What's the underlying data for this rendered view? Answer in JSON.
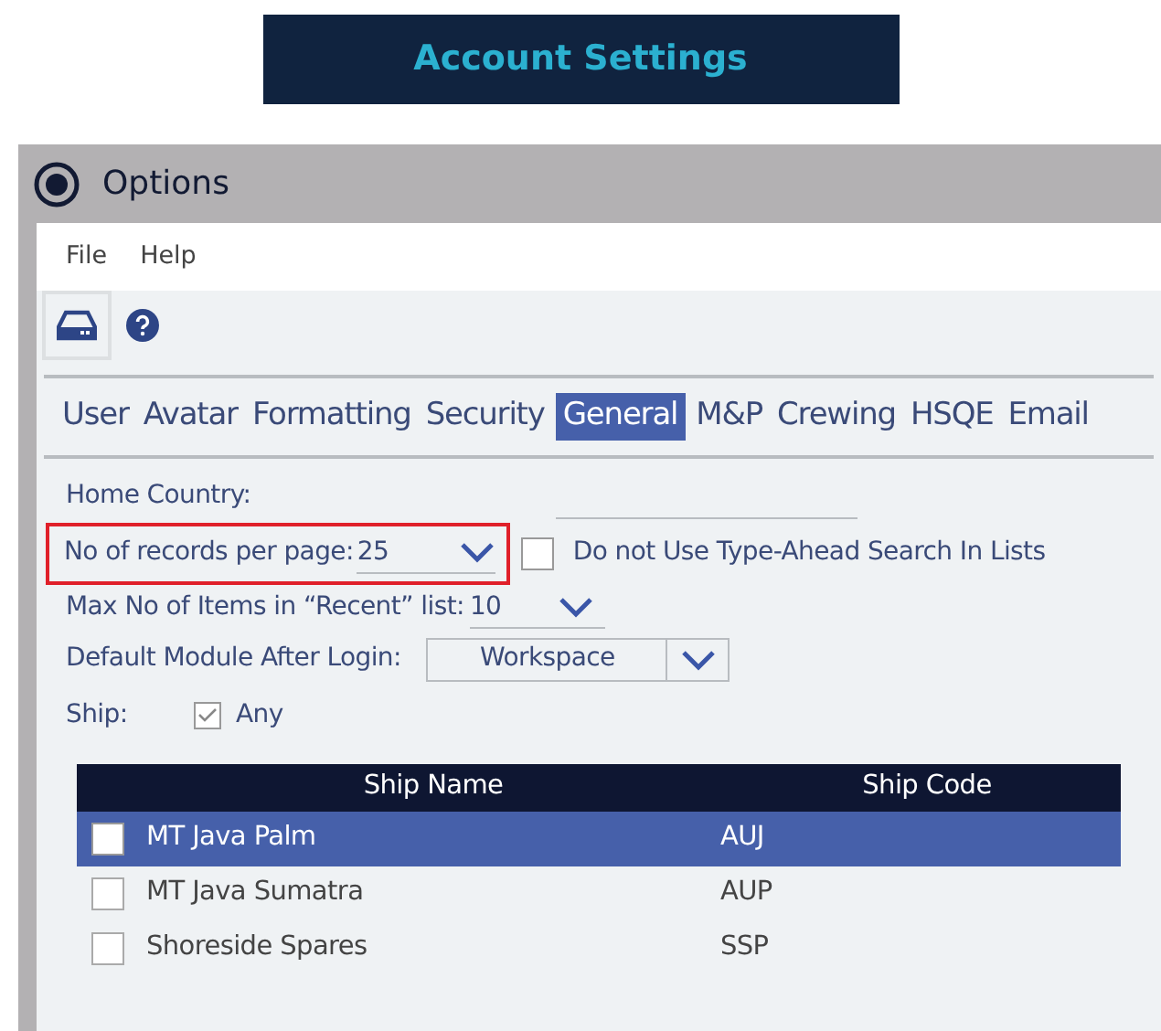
{
  "banner": {
    "title": "Account Settings"
  },
  "window": {
    "title": "Options"
  },
  "menu": [
    "File",
    "Help"
  ],
  "tabs": [
    {
      "label": "User",
      "selected": false
    },
    {
      "label": "Avatar",
      "selected": false
    },
    {
      "label": "Formatting",
      "selected": false
    },
    {
      "label": "Security",
      "selected": false
    },
    {
      "label": "General",
      "selected": true
    },
    {
      "label": "M&P",
      "selected": false
    },
    {
      "label": "Crewing",
      "selected": false
    },
    {
      "label": "HSQE",
      "selected": false
    },
    {
      "label": "Email",
      "selected": false
    }
  ],
  "home_country": {
    "label": "Home Country:"
  },
  "records_per_page": {
    "label": "No of records per page:",
    "value": "25",
    "highlighted": true
  },
  "type_ahead": {
    "label": "Do not Use Type-Ahead Search In Lists",
    "checked": false
  },
  "recent_items": {
    "label": "Max No of Items in “Recent” list:",
    "value": "10"
  },
  "default_module": {
    "label": "Default Module After Login:",
    "value": "Workspace"
  },
  "ship": {
    "label": "Ship:",
    "any_label": "Any",
    "any_checked": true
  },
  "table": {
    "columns": [
      "Ship Name",
      "Ship Code"
    ],
    "rows": [
      {
        "name": "MT Java Palm",
        "code": "AUJ",
        "selected": true,
        "checked": false
      },
      {
        "name": "MT Java Sumatra",
        "code": "AUP",
        "selected": false,
        "checked": false
      },
      {
        "name": "Shoreside Spares",
        "code": "SSP",
        "selected": false,
        "checked": false
      }
    ]
  }
}
